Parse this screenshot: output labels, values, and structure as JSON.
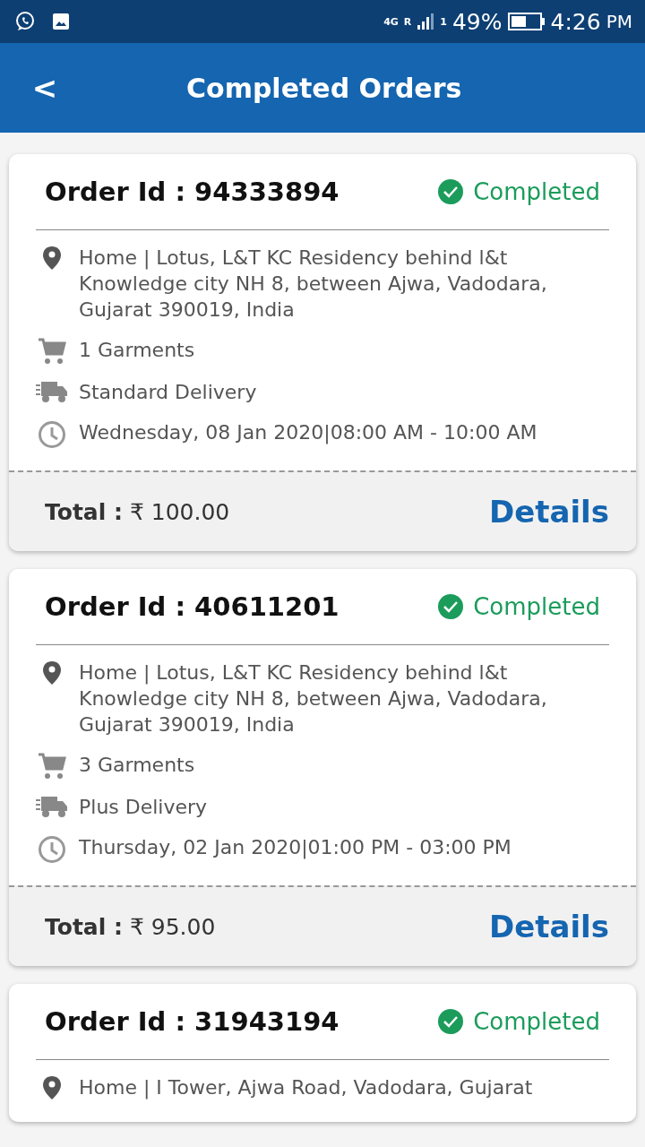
{
  "status_bar": {
    "network": "4G",
    "roaming": "R",
    "sim": "1",
    "battery": "49%",
    "time": "4:26",
    "meridiem": "PM"
  },
  "app_bar": {
    "back": "<",
    "title": "Completed Orders"
  },
  "orders": [
    {
      "order_id": "Order Id : 94333894",
      "status": {
        "kind": "completed",
        "label": "Completed"
      },
      "address": "Home | Lotus, L&T KC Residency behind l&t Knowledge city NH 8, between Ajwa, Vadodara, Gujarat 390019, India",
      "garments": "1 Garments",
      "delivery": "Standard Delivery",
      "slot": "Wednesday, 08 Jan 2020|08:00 AM - 10:00 AM",
      "total_label": "Total :",
      "total": "₹ 100.00",
      "details": "Details"
    },
    {
      "order_id": "Order Id : 40611201",
      "status": {
        "kind": "completed",
        "label": "Completed"
      },
      "address": "Home | Lotus, L&T KC Residency behind l&t Knowledge city NH 8, between Ajwa, Vadodara, Gujarat 390019, India",
      "garments": "3 Garments",
      "delivery": "Plus Delivery",
      "slot": "Thursday, 02 Jan 2020|01:00 PM - 03:00 PM",
      "total_label": "Total :",
      "total": "₹ 95.00",
      "details": "Details"
    },
    {
      "order_id": "Order Id : 31943194",
      "status": {
        "kind": "completed",
        "label": "Completed"
      },
      "address": "Home | I Tower, Ajwa Road, Vadodara, Gujarat"
    }
  ]
}
